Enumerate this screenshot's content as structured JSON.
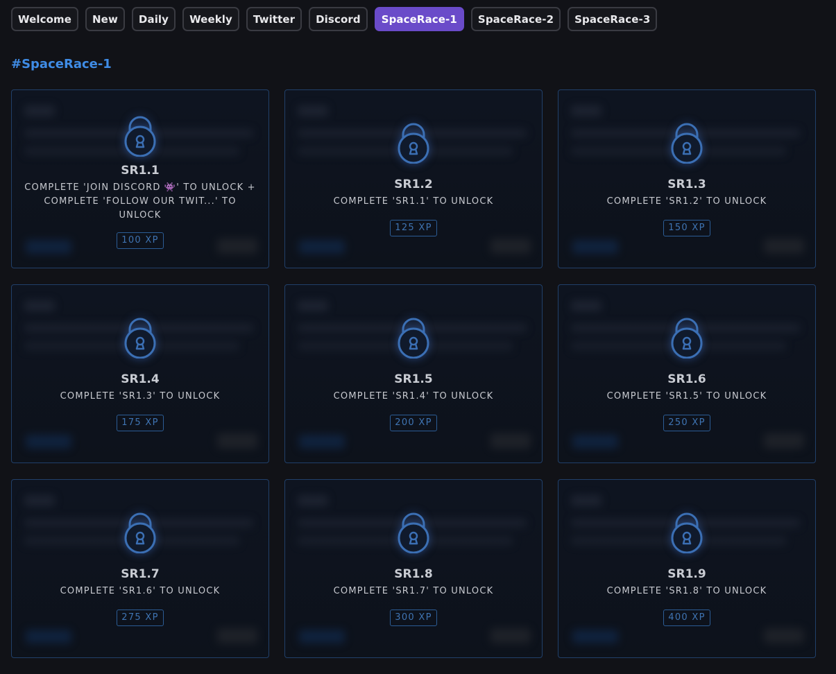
{
  "tabs": [
    {
      "label": "Welcome",
      "active": false
    },
    {
      "label": "New",
      "active": false
    },
    {
      "label": "Daily",
      "active": false
    },
    {
      "label": "Weekly",
      "active": false
    },
    {
      "label": "Twitter",
      "active": false
    },
    {
      "label": "Discord",
      "active": false
    },
    {
      "label": "SpaceRace-1",
      "active": true
    },
    {
      "label": "SpaceRace-2",
      "active": false
    },
    {
      "label": "SpaceRace-3",
      "active": false
    }
  ],
  "section": {
    "title": "#SpaceRace-1"
  },
  "colors": {
    "accent": "#6a4bc9",
    "title": "#3f8ce6",
    "lock": "#3b6fb4"
  },
  "quests": [
    {
      "id": "SR1.1",
      "requirement": "COMPLETE 'JOIN DISCORD 👾' TO UNLOCK + COMPLETE 'FOLLOW OUR TWIT...' TO UNLOCK",
      "xp": "100 XP",
      "icon": "lock-icon"
    },
    {
      "id": "SR1.2",
      "requirement": "COMPLETE 'SR1.1' TO UNLOCK",
      "xp": "125 XP",
      "icon": "lock-icon"
    },
    {
      "id": "SR1.3",
      "requirement": "COMPLETE 'SR1.2' TO UNLOCK",
      "xp": "150 XP",
      "icon": "lock-icon"
    },
    {
      "id": "SR1.4",
      "requirement": "COMPLETE 'SR1.3' TO UNLOCK",
      "xp": "175 XP",
      "icon": "lock-icon"
    },
    {
      "id": "SR1.5",
      "requirement": "COMPLETE 'SR1.4' TO UNLOCK",
      "xp": "200 XP",
      "icon": "lock-icon"
    },
    {
      "id": "SR1.6",
      "requirement": "COMPLETE 'SR1.5' TO UNLOCK",
      "xp": "250 XP",
      "icon": "lock-icon"
    },
    {
      "id": "SR1.7",
      "requirement": "COMPLETE 'SR1.6' TO UNLOCK",
      "xp": "275 XP",
      "icon": "lock-icon"
    },
    {
      "id": "SR1.8",
      "requirement": "COMPLETE 'SR1.7' TO UNLOCK",
      "xp": "300 XP",
      "icon": "lock-icon"
    },
    {
      "id": "SR1.9",
      "requirement": "COMPLETE 'SR1.8' TO UNLOCK",
      "xp": "400 XP",
      "icon": "lock-icon"
    }
  ]
}
